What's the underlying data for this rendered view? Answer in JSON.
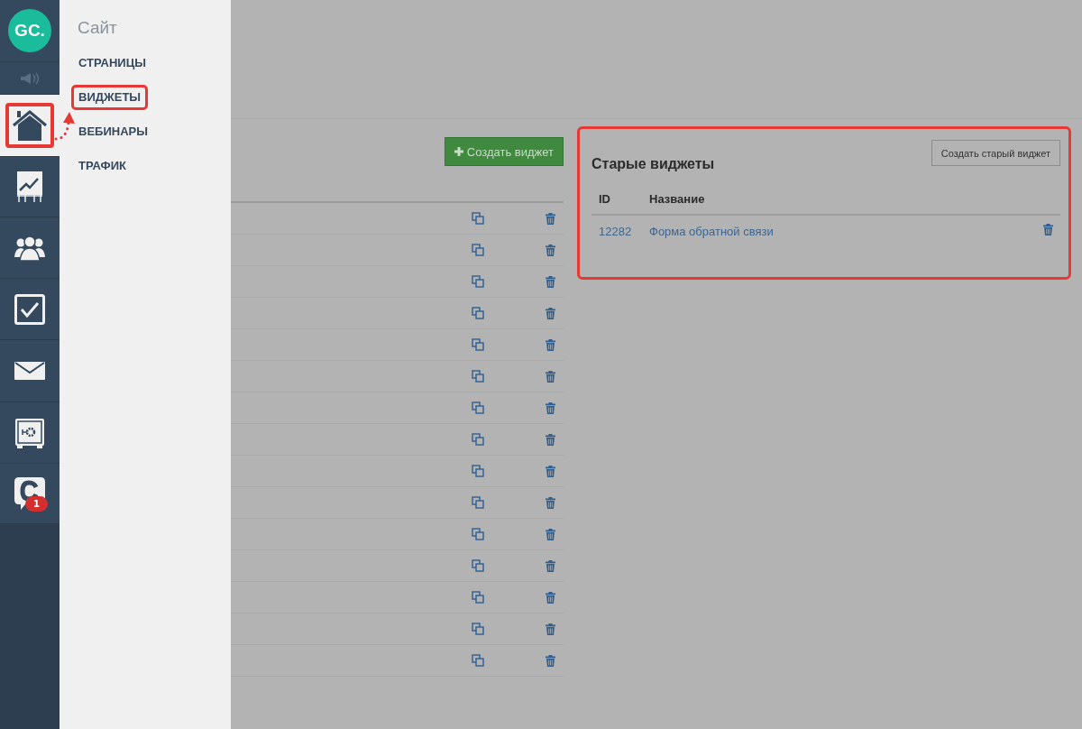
{
  "sidebar": {
    "logo": "GC.",
    "items": [
      {
        "kind": "sound",
        "selected": false,
        "highlighted": false
      },
      {
        "kind": "home",
        "selected": true,
        "highlighted": true
      },
      {
        "kind": "chart",
        "selected": false,
        "highlighted": false
      },
      {
        "kind": "users",
        "selected": false,
        "highlighted": false
      },
      {
        "kind": "tasks",
        "selected": false,
        "highlighted": false
      },
      {
        "kind": "mail",
        "selected": false,
        "highlighted": false
      },
      {
        "kind": "safe",
        "selected": false,
        "highlighted": false
      },
      {
        "kind": "chat",
        "selected": false,
        "highlighted": false,
        "badge": "1"
      }
    ]
  },
  "submenu": {
    "title": "Сайт",
    "items": [
      {
        "label": "СТРАНИЦЫ",
        "highlighted": false
      },
      {
        "label": "ВИДЖЕТЫ",
        "highlighted": true
      },
      {
        "label": "ВЕБИНАРЫ",
        "highlighted": false
      },
      {
        "label": "ТРАФИК",
        "highlighted": false
      }
    ]
  },
  "widgets": {
    "create_button": "Создать виджет",
    "rows": [
      {
        "kind": "widget"
      },
      {
        "kind": "widget"
      },
      {
        "kind": "widget"
      },
      {
        "kind": "widget"
      },
      {
        "kind": "widget"
      },
      {
        "kind": "widget"
      },
      {
        "kind": "widget"
      },
      {
        "kind": "widget"
      },
      {
        "kind": "widget"
      },
      {
        "kind": "widget"
      },
      {
        "kind": "widget"
      },
      {
        "kind": "widget"
      },
      {
        "kind": "widget"
      },
      {
        "kind": "widget"
      },
      {
        "kind": "widget"
      }
    ]
  },
  "old_widgets": {
    "title": "Старые виджеты",
    "highlighted": true,
    "create_button": "Создать старый виджет",
    "columns": [
      "ID",
      "Название"
    ],
    "rows": [
      {
        "id": "12282",
        "name": "Форма обратной связи"
      }
    ]
  }
}
